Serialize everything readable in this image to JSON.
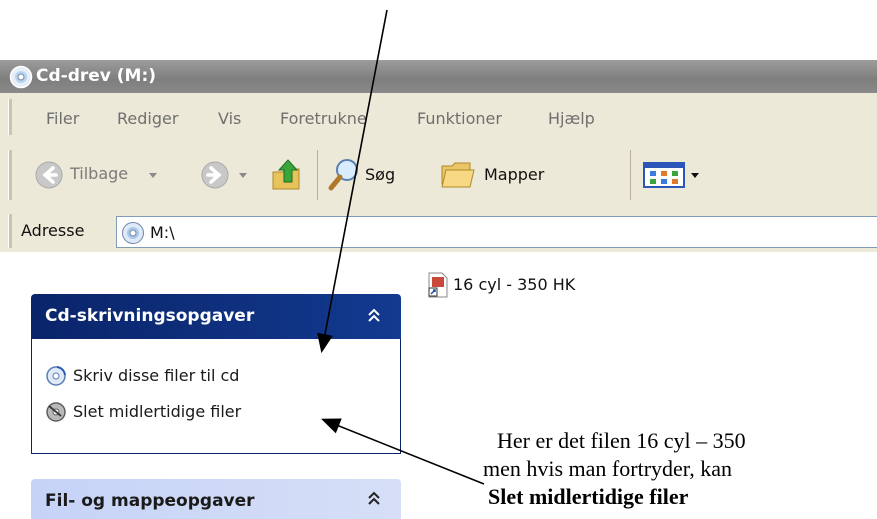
{
  "window": {
    "title": "Cd-drev (M:)"
  },
  "menu": [
    "Filer",
    "Rediger",
    "Vis",
    "Foretrukne",
    "Funktioner",
    "Hjælp"
  ],
  "toolbar": {
    "back": "Tilbage",
    "search": "Søg",
    "folders": "Mapper"
  },
  "address": {
    "label": "Adresse",
    "value": "M:\\"
  },
  "file": {
    "name": "16 cyl - 350 HK"
  },
  "tasks_cd": {
    "title": "Cd-skrivningsopgaver",
    "items": [
      "Skriv disse filer til cd",
      "Slet midlertidige filer"
    ]
  },
  "tasks_file": {
    "title": "Fil- og mappeopgaver"
  },
  "annotation": {
    "line1": "Her er det filen 16 cyl – 350",
    "line2": "men hvis man fortryder, kan",
    "line3": "Slet midlertidige filer"
  }
}
